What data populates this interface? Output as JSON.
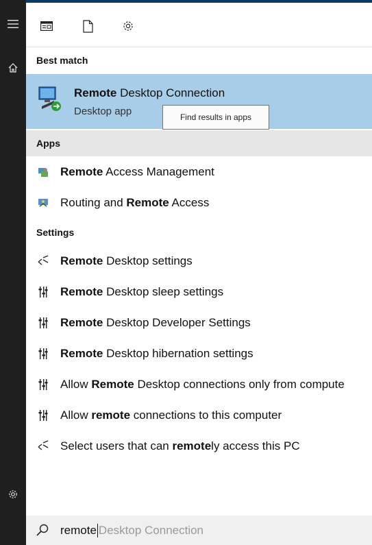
{
  "left_rail": {
    "icons": [
      "hamburger-menu-icon",
      "home-icon",
      "settings-gear-icon"
    ]
  },
  "toolbar": {
    "icons": [
      "all-view-icon",
      "document-icon",
      "settings-gear-icon"
    ]
  },
  "best_match": {
    "header": "Best match",
    "title_bold": "Remote",
    "title_rest": " Desktop Connection",
    "subtitle": "Desktop app",
    "icon": "remote-desktop-connection-icon"
  },
  "tooltip": {
    "text": "Find results in apps"
  },
  "apps": {
    "header": "Apps",
    "items": [
      {
        "pre": "",
        "bold": "Remote",
        "post": " Access Management",
        "icon": "remote-access-management-icon"
      },
      {
        "pre": "Routing and ",
        "bold": "Remote",
        "post": " Access",
        "icon": "routing-remote-access-icon"
      }
    ]
  },
  "settings": {
    "header": "Settings",
    "items": [
      {
        "pre": "",
        "bold": "Remote",
        "post": " Desktop settings",
        "icon": "remote-desktop-settings-icon"
      },
      {
        "pre": "",
        "bold": "Remote",
        "post": " Desktop sleep settings",
        "icon": "control-panel-icon"
      },
      {
        "pre": "",
        "bold": "Remote",
        "post": " Desktop Developer Settings",
        "icon": "control-panel-icon"
      },
      {
        "pre": "",
        "bold": "Remote",
        "post": " Desktop hibernation settings",
        "icon": "control-panel-icon"
      },
      {
        "pre": "Allow ",
        "bold": "Remote",
        "post": " Desktop connections only from compute",
        "icon": "control-panel-icon"
      },
      {
        "pre": "Allow ",
        "bold": "remote",
        "post": " connections to this computer",
        "icon": "control-panel-icon"
      },
      {
        "pre": "Select users that can ",
        "bold": "remote",
        "post": "ly access this PC",
        "icon": "remote-desktop-settings-icon"
      }
    ]
  },
  "search": {
    "typed": "remote",
    "suggestion": "Desktop Connection",
    "icon": "search-icon"
  },
  "colors": {
    "rail_bg": "#1f1f1f",
    "selected_bg": "#a8cde8",
    "apps_header_bg": "#e6e6e6",
    "search_bg": "#f0f0f0"
  }
}
